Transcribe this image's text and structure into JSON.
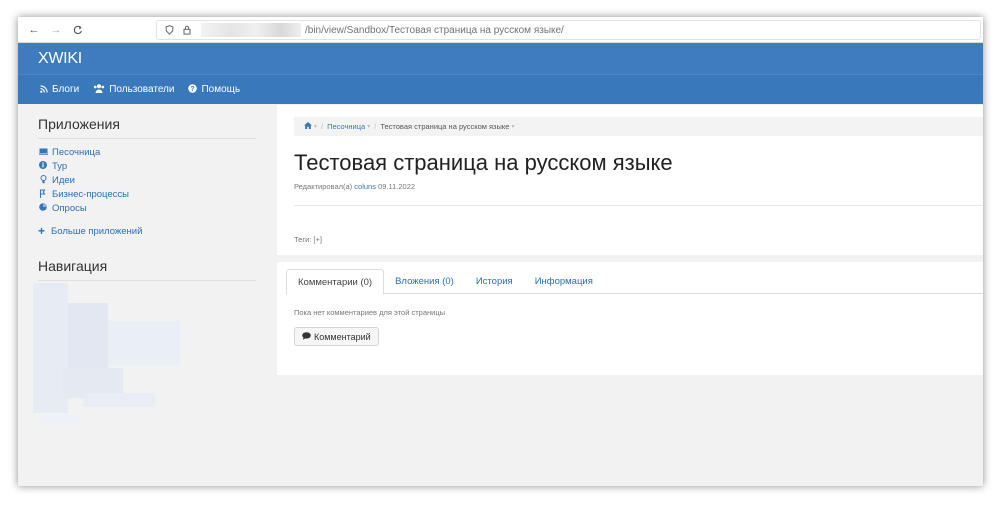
{
  "browser": {
    "back_icon": "←",
    "forward_icon": "→",
    "reload_icon": "C",
    "url_path": "/bin/view/Sandbox/Тестовая страница на русском языке/"
  },
  "header": {
    "logo": "XWIKI",
    "menu": [
      {
        "icon": "rss-icon",
        "label": "Блоги"
      },
      {
        "icon": "users-icon",
        "label": "Пользователи"
      },
      {
        "icon": "help-icon",
        "label": "Помощь"
      }
    ]
  },
  "sidebar": {
    "applications_title": "Приложения",
    "apps": [
      {
        "icon": "sandbox-icon",
        "label": "Песочница"
      },
      {
        "icon": "info-icon",
        "label": "Тур"
      },
      {
        "icon": "lightbulb-icon",
        "label": "Идеи"
      },
      {
        "icon": "process-icon",
        "label": "Бизнес-процессы"
      },
      {
        "icon": "pie-chart-icon",
        "label": "Опросы"
      }
    ],
    "more_apps": "Больше приложений",
    "navigation_title": "Навигация"
  },
  "main": {
    "breadcrumb": {
      "parent": "Песочница",
      "current": "Тестовая страница на русском языке"
    },
    "title": "Тестовая страница на русском языке",
    "meta": {
      "edited_by_label": "Редактировал(а)",
      "user": "coluns",
      "date": "09.11.2022"
    },
    "tags": "Теги: [+]",
    "tabs": [
      {
        "label": "Комментарии (0)",
        "active": true
      },
      {
        "label": "Вложения (0)",
        "active": false
      },
      {
        "label": "История",
        "active": false
      },
      {
        "label": "Информация",
        "active": false
      }
    ],
    "no_comments": "Пока нет комментариев для этой страницы",
    "comment_button": "Комментарий"
  },
  "colors": {
    "header_blue": "#3e7cbf",
    "link_blue": "#2a6fb6"
  }
}
